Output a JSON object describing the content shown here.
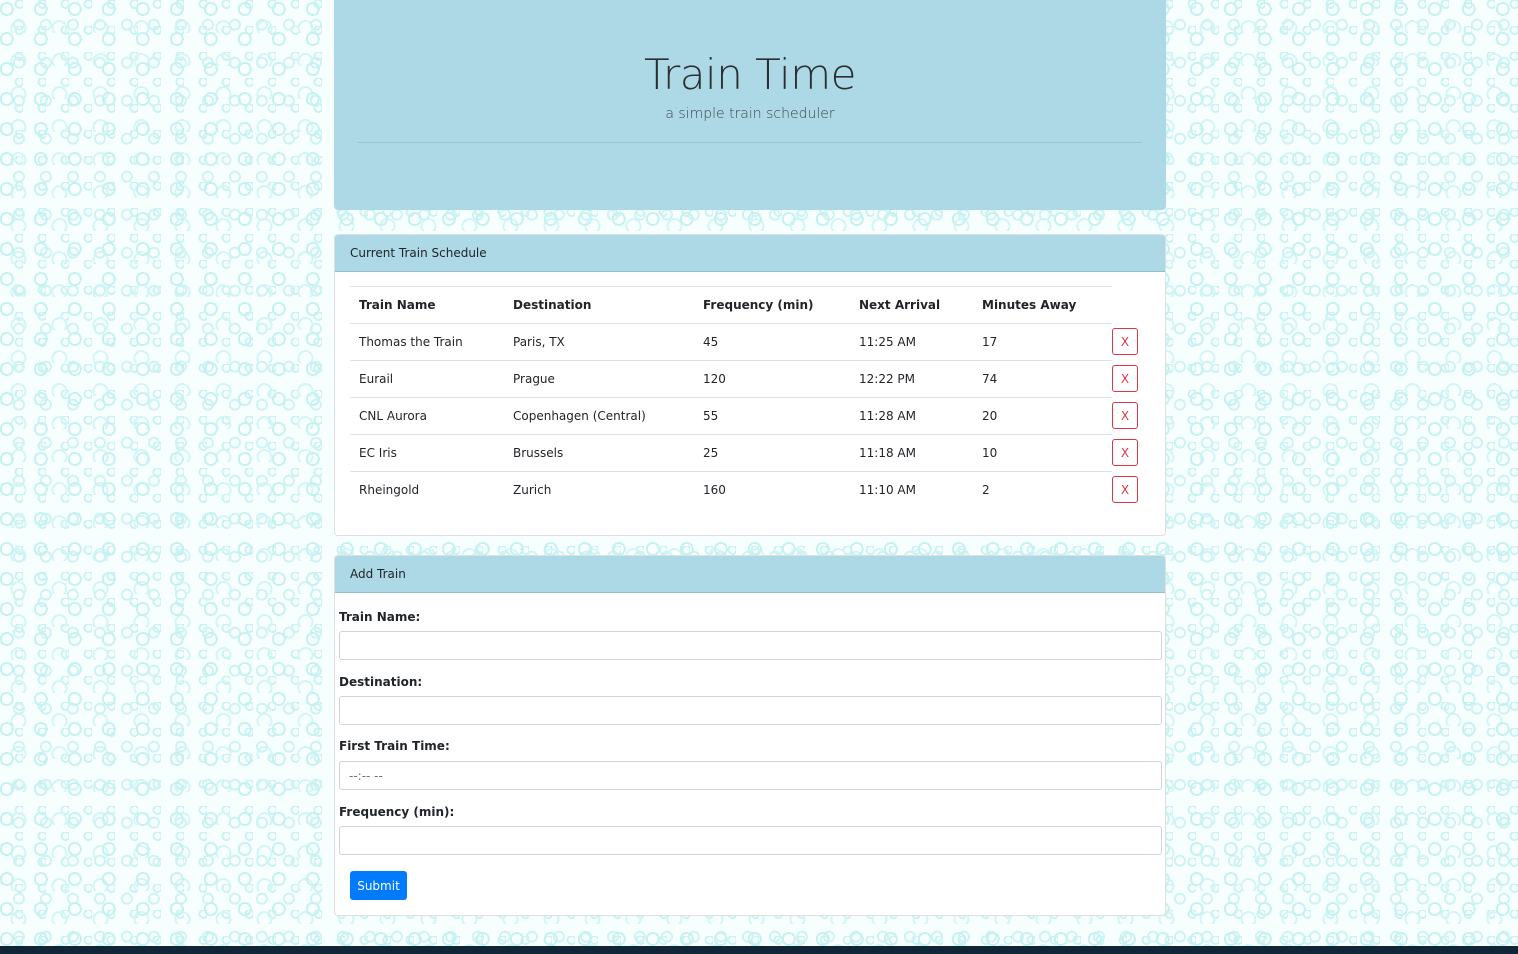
{
  "header": {
    "title": "Train Time",
    "subtitle": "a simple train scheduler",
    "background_color": "#add8e6"
  },
  "schedule": {
    "heading": "Current Train Schedule",
    "columns": [
      "Train Name",
      "Destination",
      "Frequency (min)",
      "Next Arrival",
      "Minutes Away"
    ],
    "rows": [
      [
        "Thomas the Train",
        "Paris, TX",
        "45",
        "11:25 AM",
        "17"
      ],
      [
        "Eurail",
        "Prague",
        "120",
        "12:22 PM",
        "74"
      ],
      [
        "CNL Aurora",
        "Copenhagen (Central)",
        "55",
        "11:28 AM",
        "20"
      ],
      [
        "EC Iris",
        "Brussels",
        "25",
        "11:18 AM",
        "10"
      ],
      [
        "Rheingold",
        "Zurich",
        "160",
        "11:10 AM",
        "2"
      ]
    ],
    "delete_label": "X",
    "delete_color": "#dc3545"
  },
  "add_train": {
    "heading": "Add Train",
    "fields": {
      "train_name": {
        "label": "Train Name:",
        "value": "",
        "placeholder": ""
      },
      "destination": {
        "label": "Destination:",
        "value": "",
        "placeholder": ""
      },
      "first_train_time": {
        "label": "First Train Time:",
        "value": "",
        "placeholder": "--:-- --"
      },
      "frequency": {
        "label": "Frequency (min):",
        "value": "",
        "placeholder": ""
      }
    },
    "submit_label": "Submit",
    "submit_color": "#007bff"
  }
}
